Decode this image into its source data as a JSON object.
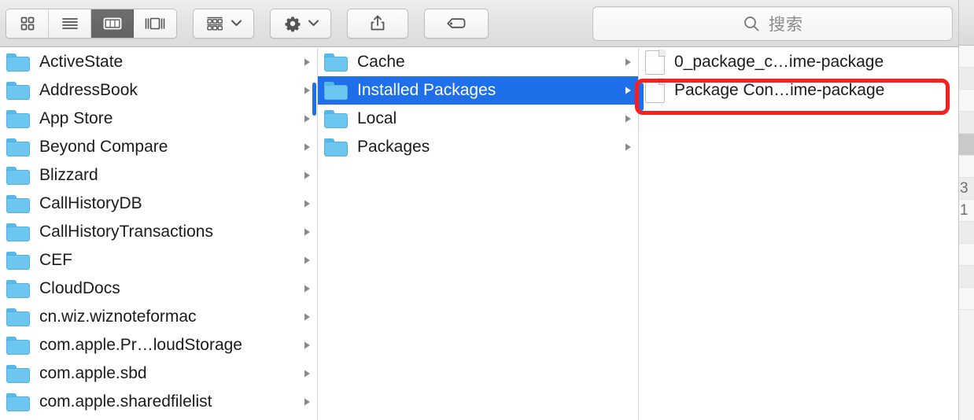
{
  "window": {
    "app": "Finder",
    "view_mode": "column"
  },
  "toolbar": {
    "view_modes": [
      {
        "id": "icon-view",
        "label": "Icon View",
        "icon": "grid-icon",
        "active": false
      },
      {
        "id": "list-view",
        "label": "List View",
        "icon": "list-icon",
        "active": false
      },
      {
        "id": "column-view",
        "label": "Column View",
        "icon": "columns-icon",
        "active": true
      },
      {
        "id": "gallery-view",
        "label": "Gallery View",
        "icon": "gallery-icon",
        "active": false
      }
    ],
    "arrange": {
      "label": "Arrange",
      "icon": "arrange-grid-icon",
      "chevron": "chevron-down-icon"
    },
    "action": {
      "label": "Action",
      "icon": "gear-icon",
      "chevron": "chevron-down-icon"
    },
    "share": {
      "label": "Share",
      "icon": "share-icon"
    },
    "tags": {
      "label": "Tags",
      "icon": "tag-icon"
    }
  },
  "search": {
    "placeholder": "搜索",
    "value": "",
    "icon": "search-icon"
  },
  "columns": [
    {
      "name": "column-1",
      "items": [
        {
          "label": "ActiveState",
          "kind": "folder",
          "has_children": true,
          "selected": false
        },
        {
          "label": "AddressBook",
          "kind": "folder",
          "has_children": true,
          "selected": false
        },
        {
          "label": "App Store",
          "kind": "folder",
          "has_children": true,
          "selected": false
        },
        {
          "label": "Beyond Compare",
          "kind": "folder",
          "has_children": true,
          "selected": false
        },
        {
          "label": "Blizzard",
          "kind": "folder",
          "has_children": true,
          "selected": false
        },
        {
          "label": "CallHistoryDB",
          "kind": "folder",
          "has_children": true,
          "selected": false
        },
        {
          "label": "CallHistoryTransactions",
          "kind": "folder",
          "has_children": true,
          "selected": false
        },
        {
          "label": "CEF",
          "kind": "folder",
          "has_children": true,
          "selected": false
        },
        {
          "label": "CloudDocs",
          "kind": "folder",
          "has_children": true,
          "selected": false
        },
        {
          "label": "cn.wiz.wiznoteformac",
          "kind": "folder",
          "has_children": true,
          "selected": false
        },
        {
          "label": "com.apple.Pr…loudStorage",
          "kind": "folder",
          "has_children": true,
          "selected": false
        },
        {
          "label": "com.apple.sbd",
          "kind": "folder",
          "has_children": true,
          "selected": false
        },
        {
          "label": "com.apple.sharedfilelist",
          "kind": "folder",
          "has_children": true,
          "selected": false
        }
      ]
    },
    {
      "name": "column-2",
      "items": [
        {
          "label": "Cache",
          "kind": "folder",
          "has_children": true,
          "selected": false
        },
        {
          "label": "Installed Packages",
          "kind": "folder",
          "has_children": true,
          "selected": true
        },
        {
          "label": "Local",
          "kind": "folder",
          "has_children": true,
          "selected": false
        },
        {
          "label": "Packages",
          "kind": "folder",
          "has_children": true,
          "selected": false
        }
      ]
    },
    {
      "name": "column-3",
      "items": [
        {
          "label": "0_package_c…ime-package",
          "kind": "file",
          "has_children": false,
          "selected": false
        },
        {
          "label": "Package Con…ime-package",
          "kind": "file",
          "has_children": false,
          "selected": false
        }
      ]
    }
  ],
  "annotation": {
    "kind": "highlight-rectangle",
    "color": "#f81f1f",
    "targets": "Package Con…ime-package"
  },
  "background_window": {
    "rows": [
      "",
      "",
      "",
      "",
      "",
      "",
      "3",
      "1",
      "",
      "",
      "",
      ""
    ]
  },
  "colors": {
    "selection_blue": "#1f6feb",
    "folder_blue": "#6dc6f0",
    "annotation_red": "#f81f1f",
    "toolbar_gray": "#e3e3e3"
  }
}
